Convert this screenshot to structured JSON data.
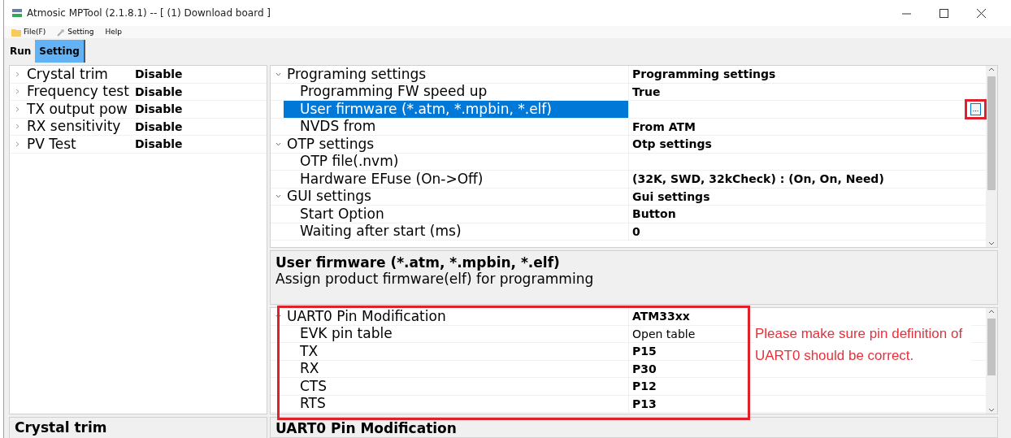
{
  "window": {
    "title": "Atmosic MPTool (2.1.8.1) --  [ (1) Download board ]"
  },
  "menu": [
    {
      "label": "File(F)",
      "kind": "folder"
    },
    {
      "label": "Setting",
      "kind": "wrench"
    },
    {
      "label": "Help",
      "kind": "plain"
    }
  ],
  "tabs": [
    {
      "label": "Run",
      "selected": false
    },
    {
      "label": "Setting",
      "selected": true
    }
  ],
  "test_list": [
    {
      "label": "Crystal trim",
      "value": "Disable",
      "expanded": false
    },
    {
      "label": "Frequency test",
      "value": "Disable",
      "expanded": false
    },
    {
      "label": "TX  output pow",
      "value": "Disable",
      "expanded": false
    },
    {
      "label": "RX  sensitivity",
      "value": "Disable",
      "expanded": false
    },
    {
      "label": "PV Test",
      "value": "Disable",
      "expanded": false
    }
  ],
  "test_description": {
    "title": "Crystal trim"
  },
  "settings_grid": {
    "annotated": true,
    "groups": [
      {
        "label": "Programing settings",
        "value": "Programming settings",
        "expanded": true,
        "children": [
          {
            "label": "Programming FW speed up",
            "value": "True",
            "selected": false
          },
          {
            "label": "User firmware (*.atm, *.mpbin, *.elf)",
            "selected": true,
            "browse_button": "..."
          },
          {
            "label": "NVDS from",
            "value": "From ATM",
            "selected": false
          }
        ]
      },
      {
        "label": "OTP settings",
        "value": "Otp settings",
        "expanded": true,
        "children": [
          {
            "label": "OTP file(.nvm)",
            "selected": false
          },
          {
            "label": "Hardware EFuse (On->Off)",
            "value": "(32K, SWD, 32kCheck) : (On, On, Need)",
            "selected": false
          }
        ]
      },
      {
        "label": "GUI settings",
        "value": "Gui settings",
        "expanded": true,
        "children": [
          {
            "label": "Start Option",
            "value": "Button",
            "selected": false
          },
          {
            "label": "Waiting after start (ms)",
            "value": "0",
            "selected": false
          }
        ]
      }
    ]
  },
  "settings_description": {
    "title": "User firmware (*.atm, *.mpbin, *.elf)",
    "text": "Assign product firmware(elf) for programming"
  },
  "pin_grid": {
    "annotated": true,
    "note": "Please make sure pin definition of UART0 should be correct.",
    "groups": [
      {
        "label": "UART0 Pin Modification",
        "value": "ATM33xx",
        "expanded": true,
        "children": [
          {
            "label": "EVK pin table",
            "value": "Open table",
            "selected": false,
            "kind": "link"
          },
          {
            "label": "TX",
            "value": "P15",
            "selected": false,
            "kind": "value"
          },
          {
            "label": "RX",
            "value": "P30",
            "selected": false,
            "kind": "value"
          },
          {
            "label": "CTS",
            "value": "P12",
            "selected": false,
            "kind": "value"
          },
          {
            "label": "RTS",
            "value": "P13",
            "selected": false,
            "kind": "value"
          }
        ]
      }
    ]
  },
  "pin_description": {
    "title": "UART0 Pin Modification"
  }
}
